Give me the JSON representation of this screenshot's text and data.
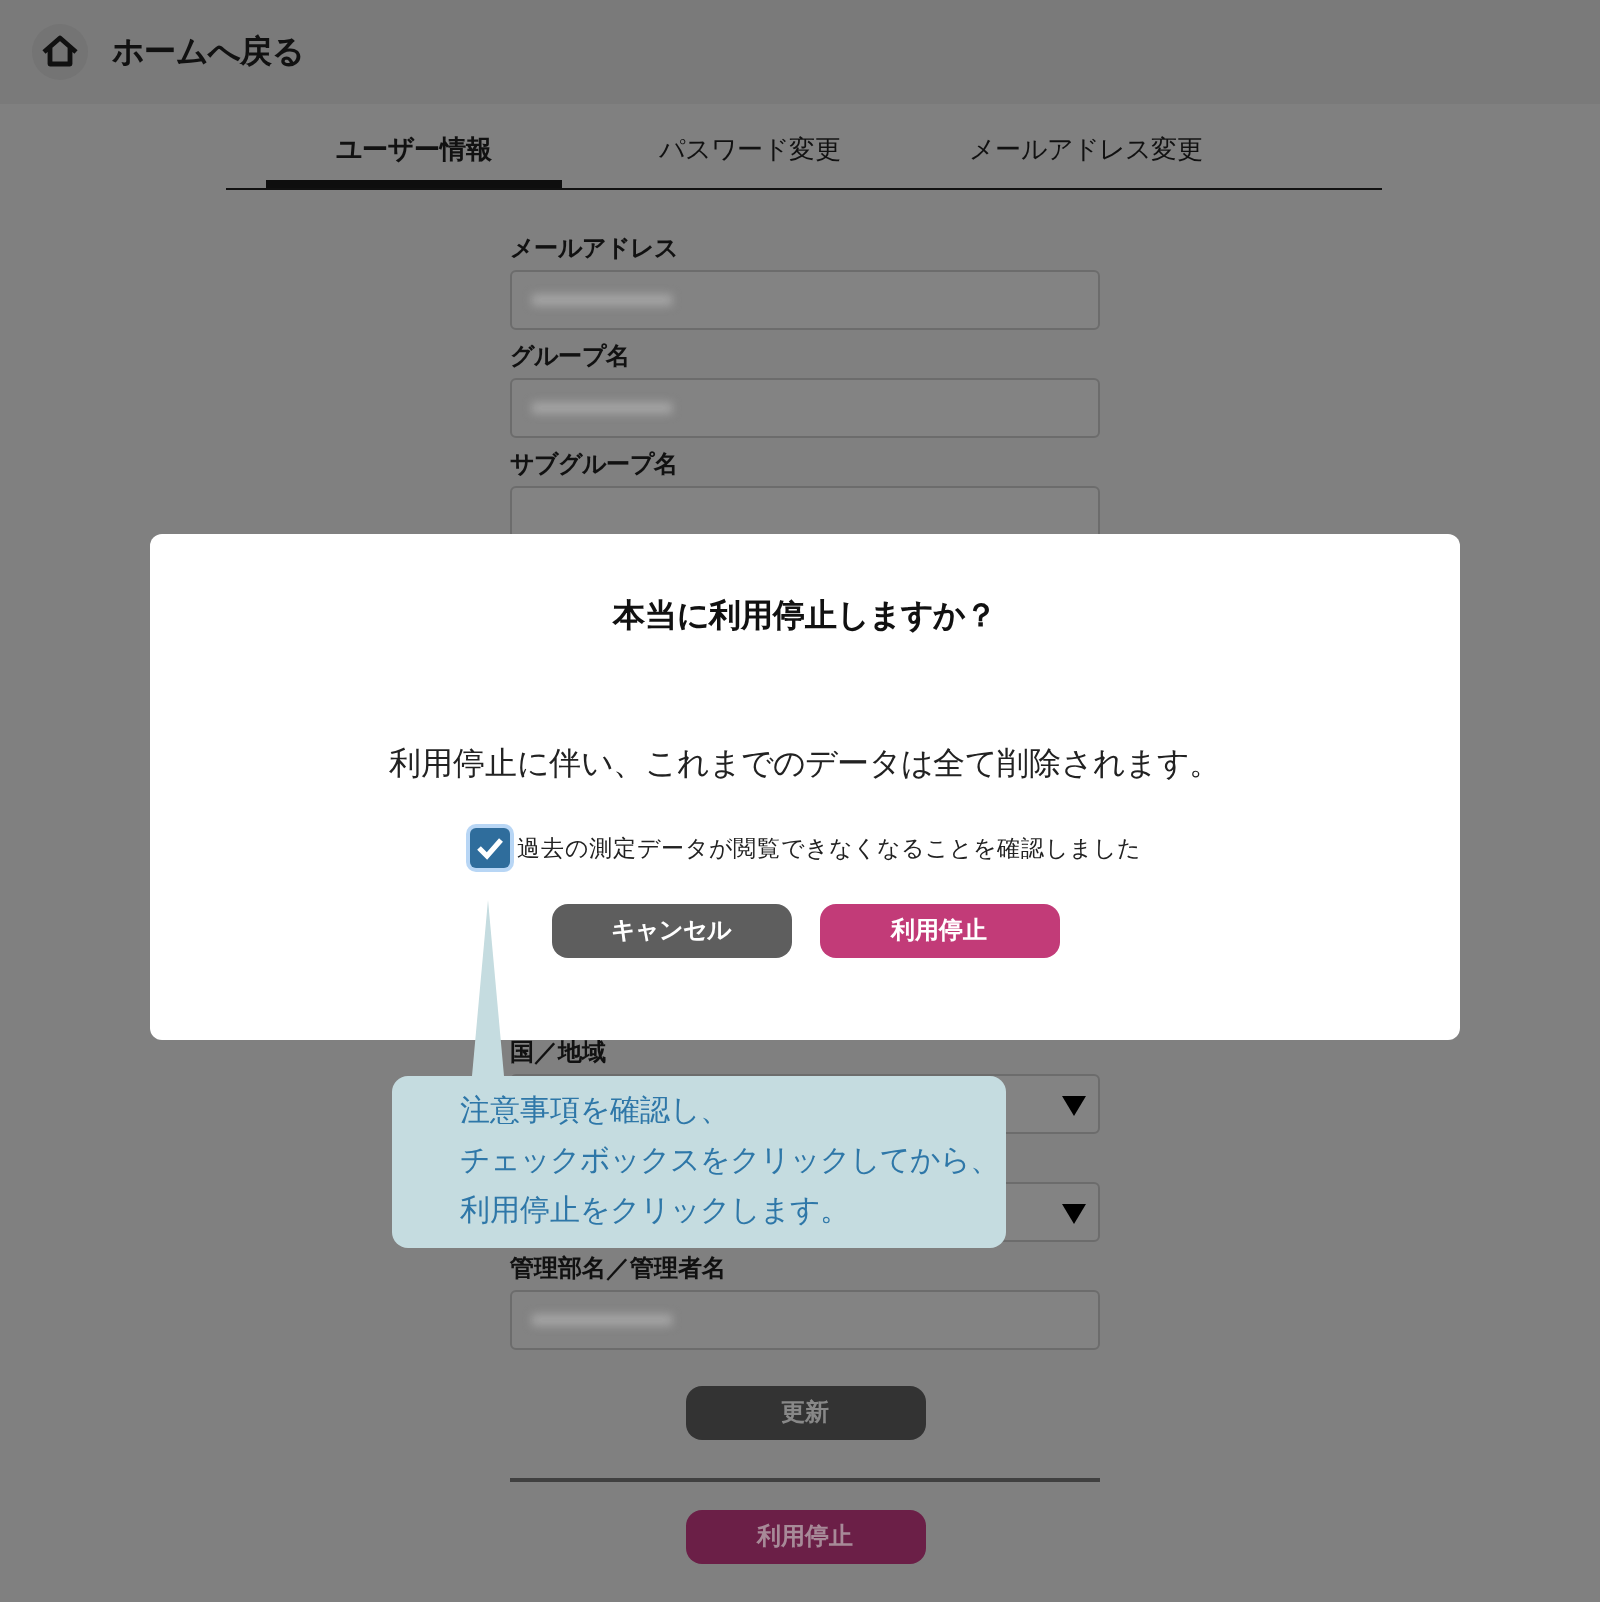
{
  "header": {
    "title": "ホームへ戻る"
  },
  "tabs": [
    {
      "label": "ユーザー情報",
      "selected": true
    },
    {
      "label": "パスワード変更",
      "selected": false
    },
    {
      "label": "メールアドレス変更",
      "selected": false
    }
  ],
  "fields_top": [
    {
      "kind": "input",
      "label": "メールアドレス",
      "blurred": true
    },
    {
      "kind": "input",
      "label": "グループ名",
      "blurred": true
    },
    {
      "kind": "input",
      "label": "サブグループ名",
      "blurred": false
    }
  ],
  "fields_bottom": [
    {
      "kind": "select",
      "label": "国／地域"
    },
    {
      "kind": "select"
    },
    {
      "kind": "input",
      "label": "管理部名／管理者名",
      "blurred": true
    }
  ],
  "update_button": "更新",
  "stop_button": "利用停止",
  "dialog": {
    "title": "本当に利用停止しますか？",
    "message": "利用停止に伴い、これまでのデータは全て削除されます。",
    "checkbox": {
      "label": "過去の測定データが閲覧できなくなることを確認しました",
      "checked": true
    },
    "buttons": [
      {
        "kind": "cancel",
        "label": "キャンセル"
      },
      {
        "kind": "confirm",
        "label": "利用停止"
      }
    ]
  },
  "callout": {
    "lines": [
      "注意事項を確認し、",
      "チェックボックスをクリックしてから、",
      "利用停止をクリックします。"
    ]
  }
}
